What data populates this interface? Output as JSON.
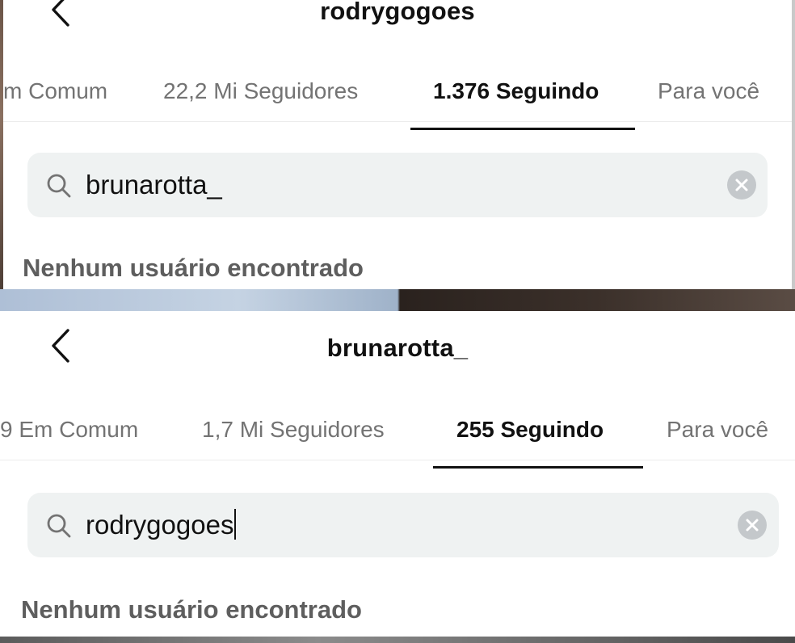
{
  "panels": [
    {
      "username": "rodrygogoes",
      "tabs": [
        {
          "label": "m Comum"
        },
        {
          "label": "22,2 Mi Seguidores"
        },
        {
          "label": "1.376 Seguindo"
        },
        {
          "label": "Para você"
        }
      ],
      "active_tab": "1.376 Seguindo",
      "search": {
        "value": "brunarotta_"
      },
      "empty_message": "Nenhum usuário encontrado"
    },
    {
      "username": "brunarotta_",
      "tabs": [
        {
          "label": "9 Em Comum"
        },
        {
          "label": "1,7 Mi Seguidores"
        },
        {
          "label": "255 Seguindo"
        },
        {
          "label": "Para você"
        }
      ],
      "active_tab": "255 Seguindo",
      "search": {
        "value": "rodrygogoes"
      },
      "empty_message": "Nenhum usuário encontrado"
    }
  ],
  "icons": {
    "back": "chevron-left-icon",
    "search": "magnifier-icon",
    "clear": "x-circle-icon"
  },
  "colors": {
    "text_primary": "#111111",
    "text_secondary": "#737373",
    "search_bg": "#eff2f2",
    "clear_bg": "#c4c8cb",
    "empty_text": "#5e5e5e"
  }
}
